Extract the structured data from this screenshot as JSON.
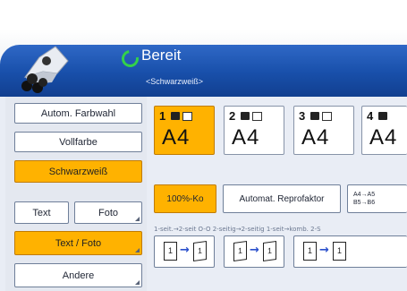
{
  "header": {
    "status": "Bereit",
    "mode": "<Schwarzweiß>"
  },
  "color_modes": {
    "auto": "Autom. Farbwahl",
    "full": "Vollfarbe",
    "bw": "Schwarzweiß",
    "selected": "bw"
  },
  "original_types": {
    "text": "Text",
    "photo": "Foto",
    "text_photo": "Text / Foto",
    "other": "Andere",
    "selected": "text_photo"
  },
  "trays": [
    {
      "number": "1",
      "size": "A4",
      "selected": true
    },
    {
      "number": "2",
      "size": "A4",
      "selected": false
    },
    {
      "number": "3",
      "size": "A4",
      "selected": false
    },
    {
      "number": "4",
      "size": "A4",
      "selected": false
    }
  ],
  "reproduction": {
    "full_size": "100%-Ko",
    "auto_reduce": "Automat. Reprofaktor",
    "preset_line1": "A4→A5",
    "preset_line2": "B5→B6"
  },
  "duplex": {
    "labels": "1-seit.→2-seit O-O   2-seitig→2-seitig   1-seit→komb. 2-S",
    "opt1_from": "1",
    "opt1_to": "1",
    "opt2_from": "1",
    "opt2_to": "1",
    "opt3_from": "1",
    "opt3_to": "1",
    "sub2": "2"
  },
  "colors": {
    "selected_fill": "#ffb200",
    "header_blue": "#184faa",
    "ready_green": "#33d24a"
  }
}
